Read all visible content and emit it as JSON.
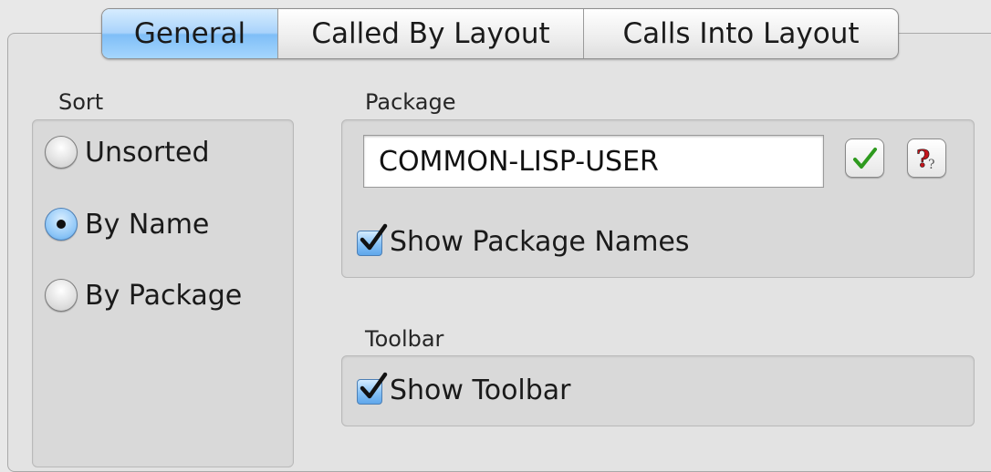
{
  "tabs": [
    {
      "label": "General",
      "selected": true
    },
    {
      "label": "Called By Layout",
      "selected": false
    },
    {
      "label": "Calls Into Layout",
      "selected": false
    }
  ],
  "sort": {
    "label": "Sort",
    "options": [
      {
        "label": "Unsorted",
        "checked": false
      },
      {
        "label": "By Name",
        "checked": true
      },
      {
        "label": "By Package",
        "checked": false
      }
    ]
  },
  "package": {
    "label": "Package",
    "value": "COMMON-LISP-USER",
    "confirm_icon": "checkmark-icon",
    "help_icon": "question-mark-icon",
    "show_names": {
      "label": "Show Package Names",
      "checked": true
    }
  },
  "toolbar": {
    "label": "Toolbar",
    "show_toolbar": {
      "label": "Show Toolbar",
      "checked": true
    }
  },
  "colors": {
    "selected_tab": "#a9d3fb",
    "checkmark_green": "#2e9a1e",
    "help_red": "#c4161c"
  }
}
